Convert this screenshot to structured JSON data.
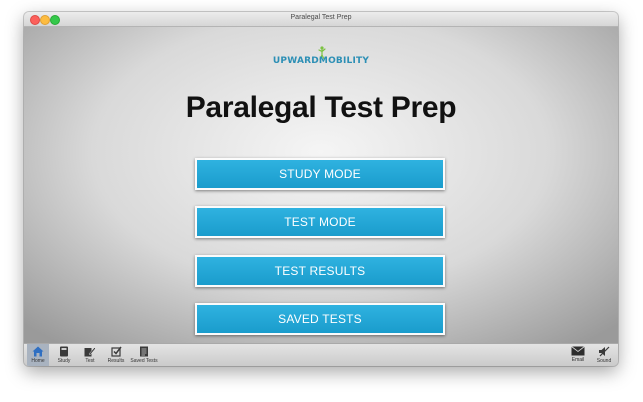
{
  "window": {
    "title": "Paralegal Test Prep"
  },
  "logo": {
    "text": "UPWARDMOBILITY"
  },
  "app_title": "Paralegal Test Prep",
  "menu": [
    {
      "label": "STUDY MODE"
    },
    {
      "label": "TEST MODE"
    },
    {
      "label": "TEST RESULTS"
    },
    {
      "label": "SAVED TESTS"
    }
  ],
  "toolbar": {
    "left": [
      {
        "label": "Home",
        "icon": "home-icon",
        "active": true
      },
      {
        "label": "Study",
        "icon": "book-icon"
      },
      {
        "label": "Test",
        "icon": "pencil-icon"
      },
      {
        "label": "Results",
        "icon": "checkbox-icon"
      },
      {
        "label": "Saved Tests",
        "icon": "document-icon"
      }
    ],
    "right": [
      {
        "label": "Email",
        "icon": "envelope-icon"
      },
      {
        "label": "Sound",
        "icon": "sound-muted-icon"
      }
    ]
  },
  "colors": {
    "button": "#1fa5d6",
    "button_border": "#ffffff",
    "title_text": "#111111",
    "logo": "#2c8fb5",
    "active_tab": "#a9b3c0"
  }
}
